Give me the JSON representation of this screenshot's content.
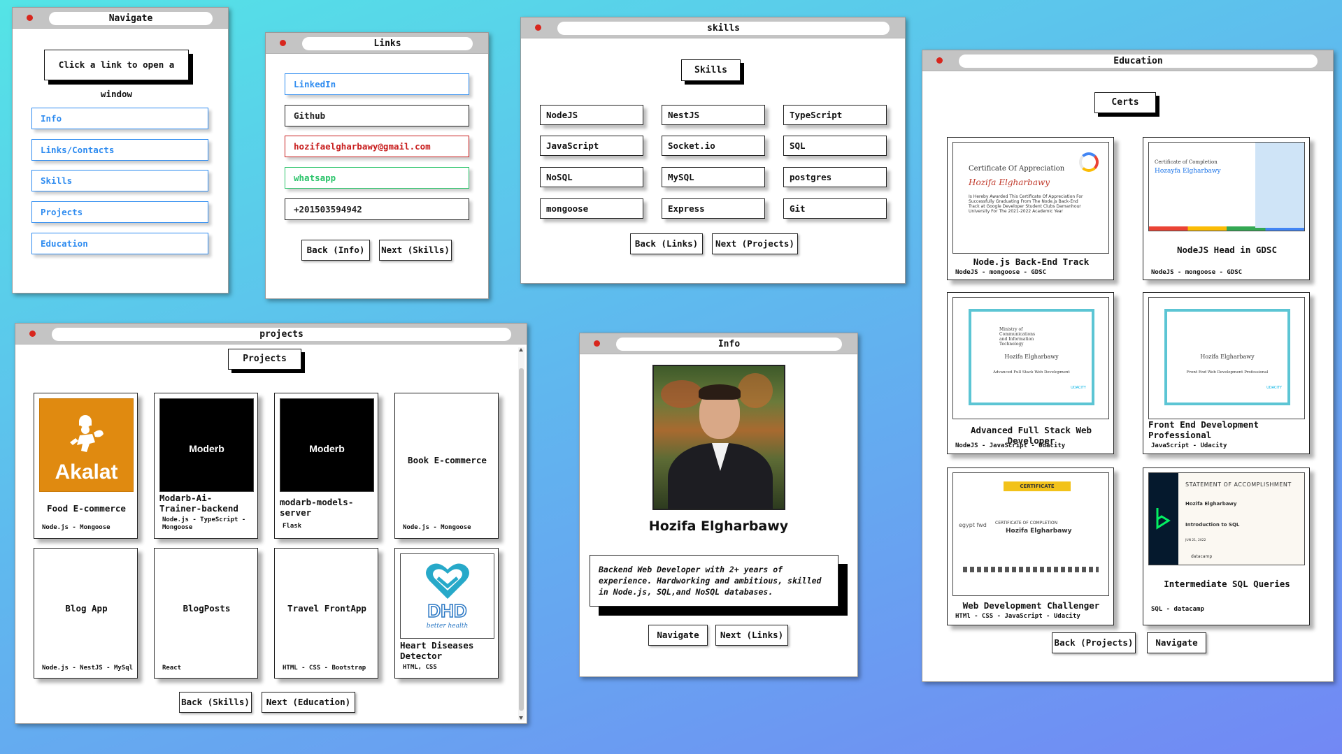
{
  "navigate": {
    "title": "Navigate",
    "banner": "Click a link to open a window",
    "links": [
      "Info",
      "Links/Contacts",
      "Skills",
      "Projects",
      "Education"
    ]
  },
  "links_window": {
    "title": "Links",
    "items": [
      {
        "label": "LinkedIn",
        "color": "#2f8cf0"
      },
      {
        "label": "Github",
        "color": "#222222"
      },
      {
        "label": "hozifaelgharbawy@gmail.com",
        "color": "#c81e1e"
      },
      {
        "label": "whatsapp",
        "color": "#2cc46b"
      },
      {
        "label": "+201503594942",
        "color": "#222222"
      }
    ],
    "back_label": "Back (Info)",
    "next_label": "Next (Skills)"
  },
  "skills_window": {
    "title": "skills",
    "heading": "Skills",
    "skills": [
      "NodeJS",
      "NestJS",
      "TypeScript",
      "JavaScript",
      "Socket.io",
      "SQL",
      "NoSQL",
      "MySQL",
      "postgres",
      "mongoose",
      "Express",
      "Git"
    ],
    "back_label": "Back (Links)",
    "next_label": "Next (Projects)"
  },
  "projects_window": {
    "title": "projects",
    "heading": "Projects",
    "projects": [
      {
        "title": "Food E-commerce",
        "stack": "Node.js - Mongoose",
        "thumb": "akalat"
      },
      {
        "title": "Modarb-Ai-Trainer-backend",
        "stack": "Node.js - TypeScript - Mongoose",
        "thumb": "moderb"
      },
      {
        "title": "modarb-models-server",
        "stack": "Flask",
        "thumb": "moderb"
      },
      {
        "title": "Book E-commerce",
        "stack": "Node.js - Mongoose",
        "thumb": ""
      },
      {
        "title": "Blog App",
        "stack": "Node.js - NestJS - MySql",
        "thumb": ""
      },
      {
        "title": "BlogPosts",
        "stack": "React",
        "thumb": ""
      },
      {
        "title": "Travel FrontApp",
        "stack": "HTML - CSS - Bootstrap",
        "thumb": ""
      },
      {
        "title": "Heart Diseases Detector",
        "stack": "HTML, CSS",
        "thumb": "dhd"
      }
    ],
    "thumb_text": {
      "akalat": "Akalat",
      "moderb": "Moderb",
      "dhd_logo": "DHD",
      "dhd_tagline": "better health"
    },
    "back_label": "Back (Skills)",
    "next_label": "Next (Education)"
  },
  "info_window": {
    "title": "Info",
    "name": "Hozifa Elgharbawy",
    "bio": "Backend Web Developer with 2+ years of experience. Hardworking and ambitious, skilled in Node.js, SQL,and NoSQL databases.",
    "navigate_label": "Navigate",
    "next_label": "Next (Links)"
  },
  "education_window": {
    "title": "Education",
    "heading": "Certs",
    "certs": [
      {
        "title": "Node.js Back-End Track",
        "sub": "NodeJS - mongoose - GDSC"
      },
      {
        "title": "NodeJS Head in GDSC",
        "sub": "NodeJS - mongoose - GDSC"
      },
      {
        "title": "Advanced Full Stack Web Developer",
        "sub": "NodeJS - JavaScript - Udacity"
      },
      {
        "title": "Front End Development Professional",
        "sub": "JavaScript - Udacity"
      },
      {
        "title": "Web Development Challenger",
        "sub": "HTMl - CSS - JavaScript - Udacity"
      },
      {
        "title": "Intermediate SQL Queries",
        "sub": "SQL - datacamp"
      }
    ],
    "cert_text": {
      "c1_heading": "Certificate Of Appreciation",
      "c1_name": "Hozifa Elgharbawy",
      "c1_body": "Is Hereby Awarded This Certificate Of Appreciation For Successfully Graduating From The Node.js Back-End Track at Google Developer Student Clubs Damanhour University For The 2021-2022 Academic Year",
      "c2_heading": "Certificate of Completion",
      "c2_name": "Hozayfa Elgharbawy",
      "c3_line1": "Ministry of Communications and Information Technology",
      "c3_name": "Hozifa Elgharbawy",
      "c3_course": "Advanced Full Stack Web Development",
      "c4_name": "Hozifa Elgharbawy",
      "c4_course": "Front End Web Development Professional",
      "c5_banner": "CERTIFICATE",
      "c5_subtitle": "CERTIFICATE OF COMPLETION",
      "c5_name": "Hozifa Elgharbawy",
      "c5_partner": "egypt fwd",
      "c6_heading": "STATEMENT OF ACCOMPLISHMENT",
      "c6_name": "Hozifa Elgharbawy",
      "c6_course": "Introduction to SQL",
      "c6_date": "JUN 21, 2022",
      "c6_brand": "datacamp",
      "udacity": "UDACITY"
    },
    "back_label": "Back (Projects)",
    "navigate_label": "Navigate"
  },
  "colors": {
    "close_dot": "#d8261d",
    "link_blue": "#2f8cf0",
    "titlebar": "#c4c4c4",
    "akalat_bg": "#e08a10",
    "dhd_teal": "#27a9c9",
    "dhd_blue": "#2b78c4",
    "udacity_teal": "#5cc5d4",
    "datacamp_green": "#03ef62"
  }
}
